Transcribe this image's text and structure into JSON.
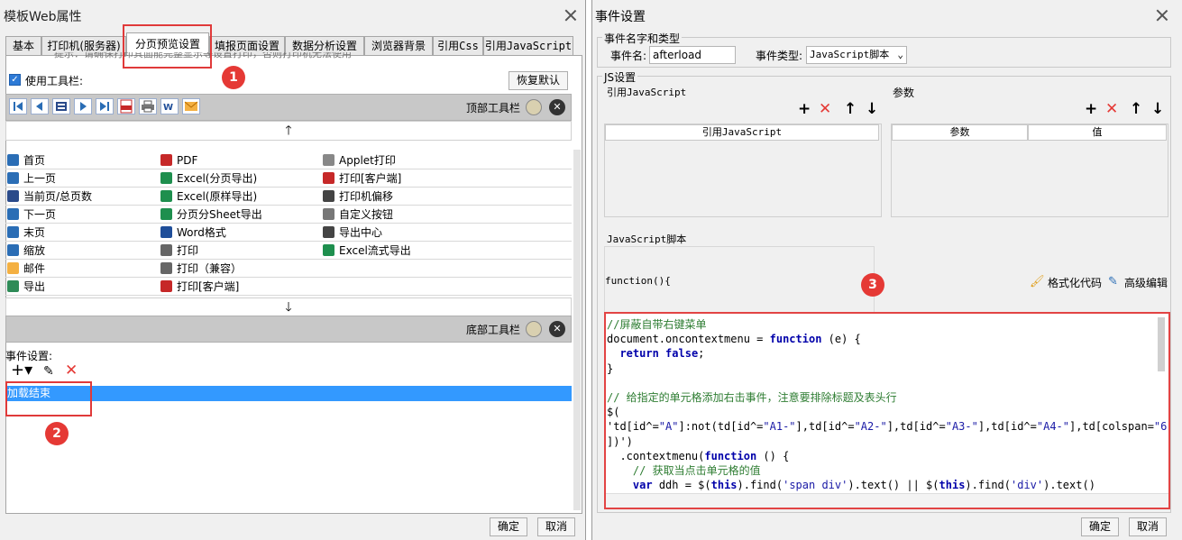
{
  "left_dialog": {
    "title": "模板Web属性",
    "tabs": [
      "基本",
      "打印机(服务器)",
      "分页预览设置",
      "填报页面设置",
      "数据分析设置",
      "浏览器背景",
      "引用Css",
      "引用JavaScript"
    ],
    "active_tab": "分页预览设置",
    "hint_text": "提示：请确保打印其面能完整显示等设置打印，否则打印机无法使用",
    "use_toolbar_label": "使用工具栏:",
    "use_toolbar_checked": true,
    "restore_default_label": "恢复默认",
    "top_toolbar_label": "顶部工具栏",
    "bottom_toolbar_label": "底部工具栏",
    "toolbar_icons": [
      "first-page-icon",
      "prev-page-icon",
      "page-number-icon",
      "next-page-icon",
      "last-page-icon",
      "pdf-icon",
      "print-icon",
      "word-icon",
      "email-icon"
    ],
    "grid": {
      "rows": [
        [
          {
            "icon": "first-page-icon",
            "label": "首页"
          },
          {
            "icon": "pdf-icon",
            "label": "PDF"
          },
          {
            "icon": "applet-print-icon",
            "label": "Applet打印"
          }
        ],
        [
          {
            "icon": "prev-page-icon",
            "label": "上一页"
          },
          {
            "icon": "excel-icon",
            "label": "Excel(分页导出)"
          },
          {
            "icon": "pdf-print-icon",
            "label": "打印[客户端]"
          }
        ],
        [
          {
            "icon": "page-number-icon",
            "label": "当前页/总页数"
          },
          {
            "icon": "excel-icon",
            "label": "Excel(原样导出)"
          },
          {
            "icon": "move-icon",
            "label": "打印机偏移"
          }
        ],
        [
          {
            "icon": "next-page-icon",
            "label": "下一页"
          },
          {
            "icon": "excel-icon",
            "label": "分页分Sheet导出"
          },
          {
            "icon": "gear-icon",
            "label": "自定义按钮"
          }
        ],
        [
          {
            "icon": "last-page-icon",
            "label": "末页"
          },
          {
            "icon": "word-icon",
            "label": "Word格式"
          },
          {
            "icon": "export-center-icon",
            "label": "导出中心"
          }
        ],
        [
          {
            "icon": "zoom-icon",
            "label": "缩放"
          },
          {
            "icon": "print-icon",
            "label": "打印"
          },
          {
            "icon": "excel-stream-icon",
            "label": "Excel流式导出"
          }
        ],
        [
          {
            "icon": "email-icon",
            "label": "邮件"
          },
          {
            "icon": "print-icon",
            "label": "打印（兼容）"
          },
          {
            "icon": "",
            "label": ""
          }
        ],
        [
          {
            "icon": "export-icon",
            "label": "导出"
          },
          {
            "icon": "flash-print-icon",
            "label": "打印[客户端]"
          },
          {
            "icon": "",
            "label": ""
          }
        ]
      ]
    },
    "event_settings_label": "事件设置:",
    "events": [
      "加载结束"
    ],
    "ok_label": "确定",
    "cancel_label": "取消",
    "badges": [
      "1",
      "2"
    ]
  },
  "right_dialog": {
    "title": "事件设置",
    "name_type_group": "事件名字和类型",
    "event_name_label": "事件名:",
    "event_name_value": "afterload",
    "event_type_label": "事件类型:",
    "event_type_value": "JavaScript脚本",
    "js_group": "JS设置",
    "ref_js_label": "引用JavaScript",
    "ref_js_column": "引用JavaScript",
    "params_label": "参数",
    "params_columns": [
      "参数",
      "值"
    ],
    "script_label": "JavaScript脚本",
    "function_header": "function(){",
    "format_code_label": "格式化代码",
    "advanced_edit_label": "高级编辑",
    "badge": "3",
    "ok_label": "确定",
    "cancel_label": "取消",
    "code_lines": [
      "//屏蔽自带右键菜单",
      "document.oncontextmenu = function (e) {",
      "  return false;",
      "}",
      "",
      "// 给指定的单元格添加右击事件，注意要排除标题及表头行",
      "$(",
      "'td[id^=\"A\"]:not(td[id^=\"A1-\"],td[id^=\"A2-\"],td[id^=\"A3-\"],td[id^=\"A4-\"],td[colspan=\"6\"",
      "])')",
      "  .contextmenu(function () {",
      "    // 获取当点击单元格的值",
      "    var ddh = $(this).find('span div').text() || $(this).find('div').text()"
    ]
  },
  "colors": {
    "accent_red": "#e53935",
    "selection_blue": "#3399ff",
    "comment_green": "#2e7d32",
    "keyword_blue": "#0000cc"
  }
}
